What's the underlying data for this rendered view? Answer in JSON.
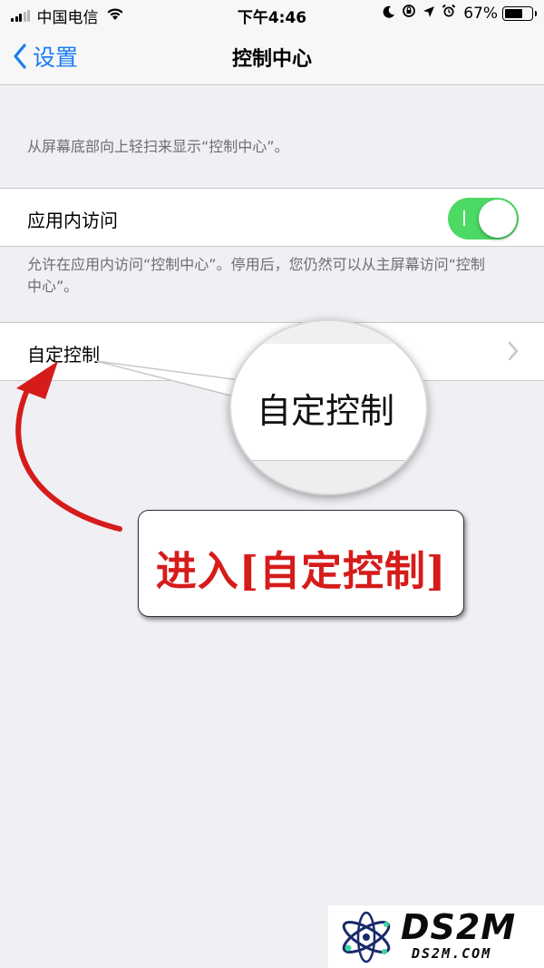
{
  "status_bar": {
    "carrier": "中国电信",
    "time": "下午4:46",
    "battery_percent": "67%",
    "battery_level": 0.67,
    "icons": [
      "signal-icon",
      "wifi-icon",
      "moon-icon",
      "rotation-lock-icon",
      "location-icon",
      "alarm-icon",
      "battery-icon"
    ]
  },
  "nav": {
    "back_label": "设置",
    "title": "控制中心"
  },
  "content": {
    "top_description": "从屏幕底部向上轻扫来显示“控制中心”。",
    "access_within_apps": {
      "label": "应用内访问",
      "toggle_on": true
    },
    "access_description": "允许在应用内访问“控制中心”。停用后，您仍然可以从主屏幕访问“控制中心”。",
    "customize_controls": {
      "label": "自定控制"
    }
  },
  "annotation": {
    "magnifier_text": "自定控制",
    "callout_text": "进入[自定控制]",
    "arrow_color": "#d61b1b"
  },
  "watermark": {
    "main": "DS2M",
    "sub": "DS2M.COM"
  },
  "colors": {
    "accent": "#1a7cf4",
    "toggle_on": "#4cd964",
    "background": "#efeff4"
  }
}
